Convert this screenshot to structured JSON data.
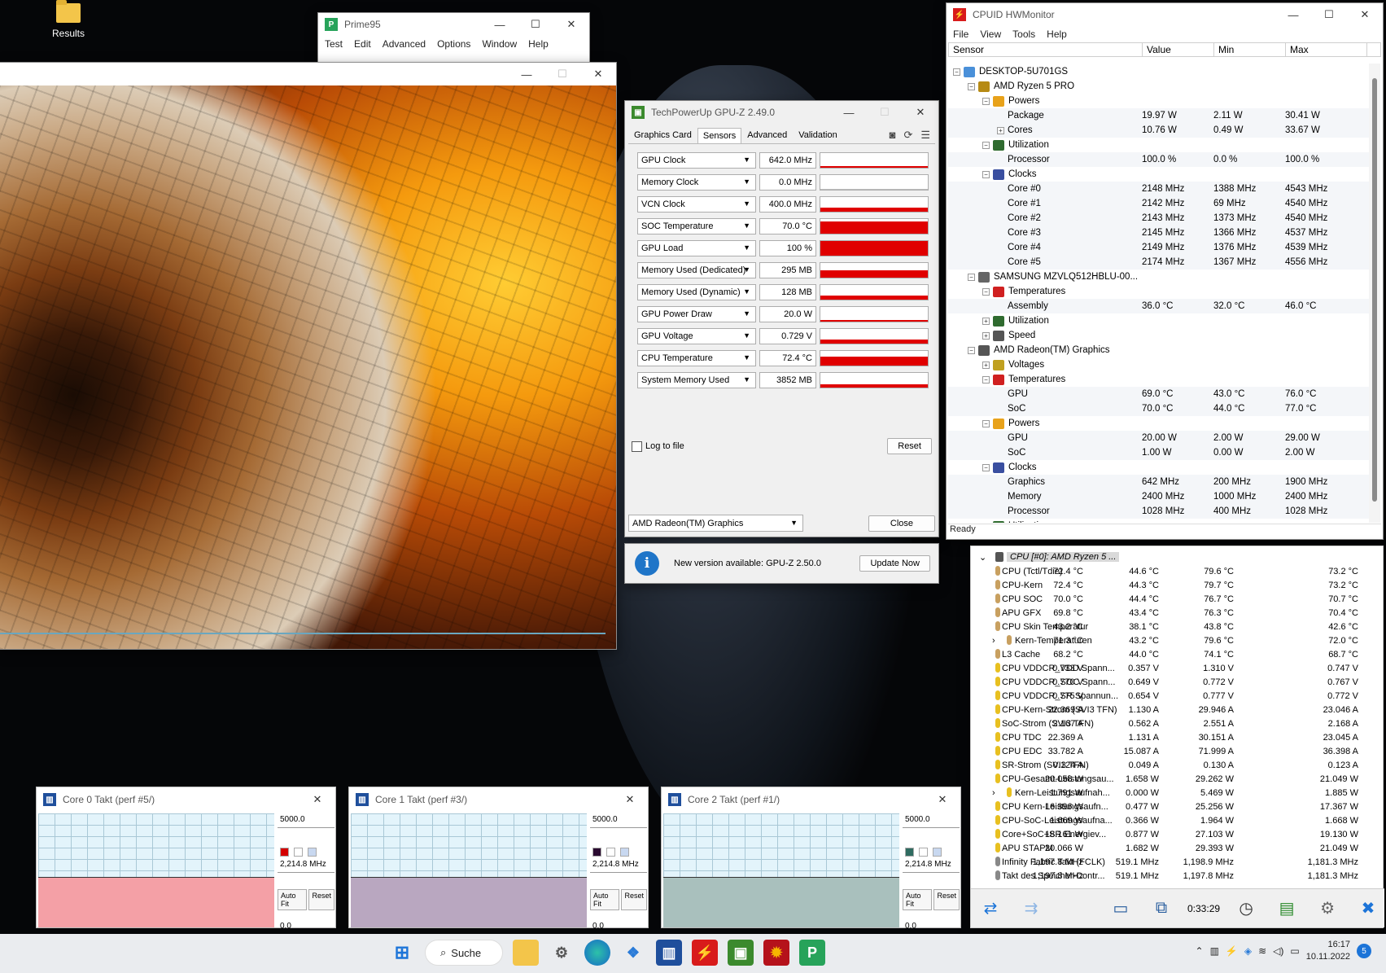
{
  "desktop": {
    "icon_label": "Results"
  },
  "prime95": {
    "title": "Prime95",
    "menu": [
      "Test",
      "Edit",
      "Advanced",
      "Options",
      "Window",
      "Help"
    ]
  },
  "gpuz": {
    "title": "TechPowerUp GPU-Z 2.49.0",
    "tabs": [
      "Graphics Card",
      "Sensors",
      "Advanced",
      "Validation"
    ],
    "active_tab": "Sensors",
    "sensors": [
      {
        "name": "GPU Clock",
        "value": "642.0 MHz",
        "level": 0.05
      },
      {
        "name": "Memory Clock",
        "value": "0.0 MHz",
        "level": 0.0
      },
      {
        "name": "VCN Clock",
        "value": "400.0 MHz",
        "level": 0.3
      },
      {
        "name": "SOC Temperature",
        "value": "70.0 °C",
        "level": 0.85
      },
      {
        "name": "GPU Load",
        "value": "100 %",
        "level": 1.0
      },
      {
        "name": "Memory Used (Dedicated)",
        "value": "295 MB",
        "level": 0.5
      },
      {
        "name": "Memory Used (Dynamic)",
        "value": "128 MB",
        "level": 0.3
      },
      {
        "name": "GPU Power Draw",
        "value": "20.0 W",
        "level": 0.05
      },
      {
        "name": "GPU Voltage",
        "value": "0.729 V",
        "level": 0.3
      },
      {
        "name": "CPU Temperature",
        "value": "72.4 °C",
        "level": 0.6
      },
      {
        "name": "System Memory Used",
        "value": "3852 MB",
        "level": 0.2
      }
    ],
    "log_label": "Log to file",
    "reset": "Reset",
    "device": "AMD Radeon(TM) Graphics",
    "close": "Close",
    "update_msg": "New version available: GPU-Z 2.50.0",
    "update_btn": "Update Now"
  },
  "hwmonitor": {
    "title": "CPUID HWMonitor",
    "menu": [
      "File",
      "View",
      "Tools",
      "Help"
    ],
    "columns": [
      "Sensor",
      "Value",
      "Min",
      "Max"
    ],
    "status": "Ready",
    "rows": [
      {
        "depth": 0,
        "toggle": "−",
        "icon": "computer",
        "name": "DESKTOP-5U701GS"
      },
      {
        "depth": 1,
        "toggle": "−",
        "icon": "cpu",
        "name": "AMD Ryzen 5 PRO"
      },
      {
        "depth": 2,
        "toggle": "−",
        "icon": "power",
        "name": "Powers"
      },
      {
        "depth": 3,
        "name": "Package",
        "value": "19.97 W",
        "min": "2.11 W",
        "max": "30.41 W"
      },
      {
        "depth": 3,
        "toggle": "+",
        "name": "Cores",
        "value": "10.76 W",
        "min": "0.49 W",
        "max": "33.67 W"
      },
      {
        "depth": 2,
        "toggle": "−",
        "icon": "util",
        "name": "Utilization"
      },
      {
        "depth": 3,
        "name": "Processor",
        "value": "100.0 %",
        "min": "0.0 %",
        "max": "100.0 %"
      },
      {
        "depth": 2,
        "toggle": "−",
        "icon": "clock",
        "name": "Clocks"
      },
      {
        "depth": 3,
        "name": "Core #0",
        "value": "2148 MHz",
        "min": "1388 MHz",
        "max": "4543 MHz"
      },
      {
        "depth": 3,
        "name": "Core #1",
        "value": "2142 MHz",
        "min": "69 MHz",
        "max": "4540 MHz"
      },
      {
        "depth": 3,
        "name": "Core #2",
        "value": "2143 MHz",
        "min": "1373 MHz",
        "max": "4540 MHz"
      },
      {
        "depth": 3,
        "name": "Core #3",
        "value": "2145 MHz",
        "min": "1366 MHz",
        "max": "4537 MHz"
      },
      {
        "depth": 3,
        "name": "Core #4",
        "value": "2149 MHz",
        "min": "1376 MHz",
        "max": "4539 MHz"
      },
      {
        "depth": 3,
        "name": "Core #5",
        "value": "2174 MHz",
        "min": "1367 MHz",
        "max": "4556 MHz"
      },
      {
        "depth": 1,
        "toggle": "−",
        "icon": "drive",
        "name": "SAMSUNG MZVLQ512HBLU-00..."
      },
      {
        "depth": 2,
        "toggle": "−",
        "icon": "temp",
        "name": "Temperatures"
      },
      {
        "depth": 3,
        "name": "Assembly",
        "value": "36.0 °C",
        "min": "32.0 °C",
        "max": "46.0 °C"
      },
      {
        "depth": 2,
        "toggle": "+",
        "icon": "util",
        "name": "Utilization"
      },
      {
        "depth": 2,
        "toggle": "+",
        "icon": "speed",
        "name": "Speed"
      },
      {
        "depth": 1,
        "toggle": "−",
        "icon": "gpu",
        "name": "AMD Radeon(TM) Graphics"
      },
      {
        "depth": 2,
        "toggle": "+",
        "icon": "volt",
        "name": "Voltages"
      },
      {
        "depth": 2,
        "toggle": "−",
        "icon": "temp",
        "name": "Temperatures"
      },
      {
        "depth": 3,
        "name": "GPU",
        "value": "69.0 °C",
        "min": "43.0 °C",
        "max": "76.0 °C"
      },
      {
        "depth": 3,
        "name": "SoC",
        "value": "70.0 °C",
        "min": "44.0 °C",
        "max": "77.0 °C"
      },
      {
        "depth": 2,
        "toggle": "−",
        "icon": "power",
        "name": "Powers"
      },
      {
        "depth": 3,
        "name": "GPU",
        "value": "20.00 W",
        "min": "2.00 W",
        "max": "29.00 W"
      },
      {
        "depth": 3,
        "name": "SoC",
        "value": "1.00 W",
        "min": "0.00 W",
        "max": "2.00 W"
      },
      {
        "depth": 2,
        "toggle": "−",
        "icon": "clock",
        "name": "Clocks"
      },
      {
        "depth": 3,
        "name": "Graphics",
        "value": "642 MHz",
        "min": "200 MHz",
        "max": "1900 MHz"
      },
      {
        "depth": 3,
        "name": "Memory",
        "value": "2400 MHz",
        "min": "1000 MHz",
        "max": "2400 MHz"
      },
      {
        "depth": 3,
        "name": "Processor",
        "value": "1028 MHz",
        "min": "400 MHz",
        "max": "1028 MHz"
      },
      {
        "depth": 2,
        "toggle": "+",
        "icon": "util",
        "name": "Utilization"
      }
    ]
  },
  "hwinfo": {
    "header": "CPU [#0]: AMD Ryzen 5 ...",
    "uptime": "0:33:29",
    "rows": [
      {
        "icon": "temp",
        "name": "CPU (Tctl/Tdie)",
        "cur": "72.4 °C",
        "min": "44.6 °C",
        "max": "79.6 °C",
        "avg": "73.2 °C"
      },
      {
        "icon": "temp",
        "name": "CPU-Kern",
        "cur": "72.4 °C",
        "min": "44.3 °C",
        "max": "79.7 °C",
        "avg": "73.2 °C"
      },
      {
        "icon": "temp",
        "name": "CPU SOC",
        "cur": "70.0 °C",
        "min": "44.4 °C",
        "max": "76.7 °C",
        "avg": "70.7 °C"
      },
      {
        "icon": "temp",
        "name": "APU GFX",
        "cur": "69.8 °C",
        "min": "43.4 °C",
        "max": "76.3 °C",
        "avg": "70.4 °C"
      },
      {
        "icon": "temp",
        "name": "CPU Skin Temperatur",
        "cur": "43.2 °C",
        "min": "38.1 °C",
        "max": "43.8 °C",
        "avg": "42.6 °C"
      },
      {
        "icon": "temp",
        "sub": true,
        "name": "Kern-Temperaturen",
        "cur": "71.3 °C",
        "min": "43.2 °C",
        "max": "79.6 °C",
        "avg": "72.0 °C"
      },
      {
        "icon": "temp",
        "name": "L3 Cache",
        "cur": "68.2 °C",
        "min": "44.0 °C",
        "max": "74.1 °C",
        "avg": "68.7 °C"
      },
      {
        "icon": "volt",
        "name": "CPU VDDCR_VDD Spann...",
        "cur": "0.733 V",
        "min": "0.357 V",
        "max": "1.310 V",
        "avg": "0.747 V"
      },
      {
        "icon": "volt",
        "name": "CPU VDDCR_SOC Spann...",
        "cur": "0.770 V",
        "min": "0.649 V",
        "max": "0.772 V",
        "avg": "0.767 V"
      },
      {
        "icon": "volt",
        "name": "CPU VDDCR_SR Spannun...",
        "cur": "0.775 V",
        "min": "0.654 V",
        "max": "0.777 V",
        "avg": "0.772 V"
      },
      {
        "icon": "volt",
        "name": "CPU-Kern-Strom (SVI3 TFN)",
        "cur": "22.369 A",
        "min": "1.130 A",
        "max": "29.946 A",
        "avg": "23.046 A"
      },
      {
        "icon": "volt",
        "name": "SoC-Strom (SVI3 TFN)",
        "cur": "2.167 A",
        "min": "0.562 A",
        "max": "2.551 A",
        "avg": "2.168 A"
      },
      {
        "icon": "volt",
        "name": "CPU TDC",
        "cur": "22.369 A",
        "min": "1.131 A",
        "max": "30.151 A",
        "avg": "23.045 A"
      },
      {
        "icon": "volt",
        "name": "CPU EDC",
        "cur": "33.782 A",
        "min": "15.087 A",
        "max": "71.999 A",
        "avg": "36.398 A"
      },
      {
        "icon": "volt",
        "name": "SR-Strom (SVI3 TFN)",
        "cur": "0.124 A",
        "min": "0.049 A",
        "max": "0.130 A",
        "avg": "0.123 A"
      },
      {
        "icon": "volt",
        "name": "CPU-Gesamt-Leistungsau...",
        "cur": "20.058 W",
        "min": "1.658 W",
        "max": "29.262 W",
        "avg": "21.049 W"
      },
      {
        "icon": "volt",
        "sub": true,
        "name": "Kern-Leistungsaufnah...",
        "cur": "1.791 W",
        "min": "0.000 W",
        "max": "5.469 W",
        "avg": "1.885 W"
      },
      {
        "icon": "volt",
        "name": "CPU Kern-Leistungsaufn...",
        "cur": "16.396 W",
        "min": "0.477 W",
        "max": "25.256 W",
        "avg": "17.367 W"
      },
      {
        "icon": "volt",
        "name": "CPU-SoC-Leistungsaufna...",
        "cur": "1.669 W",
        "min": "0.366 W",
        "max": "1.964 W",
        "avg": "1.668 W"
      },
      {
        "icon": "volt",
        "name": "Core+SoC+SR Energiev...",
        "cur": "18.161 W",
        "min": "0.877 W",
        "max": "27.103 W",
        "avg": "19.130 W"
      },
      {
        "icon": "volt",
        "name": "APU STAPM",
        "cur": "20.066 W",
        "min": "1.682 W",
        "max": "29.393 W",
        "avg": "21.049 W"
      },
      {
        "icon": "clock",
        "name": "Infinity Fabric Takt (FCLK)",
        "cur": "1,197.8 MHz",
        "min": "519.1 MHz",
        "max": "1,198.9 MHz",
        "avg": "1,181.3 MHz"
      },
      {
        "icon": "clock",
        "name": "Takt des Speicher-Contr...",
        "cur": "1,197.8 MHz",
        "min": "519.1 MHz",
        "max": "1,197.8 MHz",
        "avg": "1,181.3 MHz"
      }
    ]
  },
  "core_windows": [
    {
      "title": "Core 0 Takt (perf #5/)",
      "max": "5000.0",
      "current": "2,214.8 MHz",
      "min": "0.0",
      "color": "#f4a0a6",
      "swatch": "#d40000",
      "level": 0.44
    },
    {
      "title": "Core 1 Takt (perf #3/)",
      "max": "5000.0",
      "current": "2,214.8 MHz",
      "min": "0.0",
      "color": "#b9a7c0",
      "swatch": "#2a0a30",
      "level": 0.44
    },
    {
      "title": "Core 2 Takt (perf #1/)",
      "max": "5000.0",
      "current": "2,214.8 MHz",
      "min": "0.0",
      "color": "#a9c0bd",
      "swatch": "#2f6b60",
      "level": 0.44
    }
  ],
  "core_buttons": {
    "autofit": "Auto Fit",
    "reset": "Reset"
  },
  "taskbar": {
    "search": "Suche",
    "time": "16:17",
    "date": "10.11.2022",
    "badge": "5"
  }
}
